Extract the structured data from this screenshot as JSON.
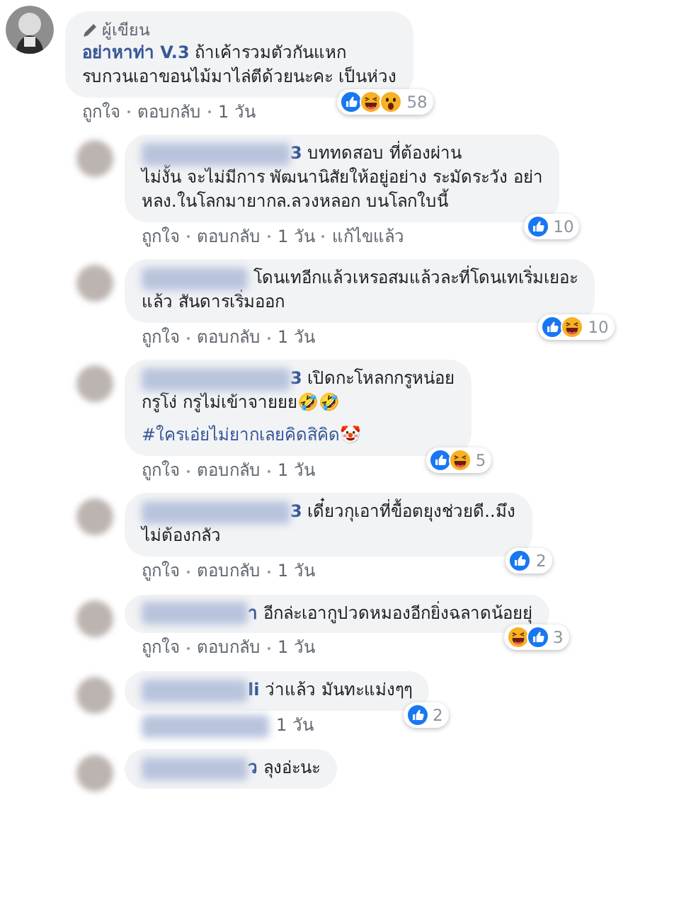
{
  "post_comment": {
    "author_badge": "ผู้เขียน",
    "name": "อย่าหาท่า V.3",
    "lines": [
      "ถ้าเค้ารวมตัวกันแหก",
      "รบกวนเอาขอนไม้มาไล่ตีด้วยนะคะ เป็นห่วง"
    ],
    "reactions": [
      {
        "kind": "like"
      },
      {
        "kind": "haha"
      },
      {
        "kind": "wow"
      }
    ],
    "reaction_count": "58",
    "actions": [
      "ถูกใจ",
      "ตอบกลับ",
      "1 วัน"
    ]
  },
  "replies": [
    {
      "name_fragment": "3",
      "lines": [
        "บททดสอบ ที่ต้องผ่าน",
        "ไม่งั้น จะไม่มีการ พัฒนานิสัยให้อยู่อย่าง ระมัดระวัง อย่า",
        "หลง.ในโลกมายากล.ลวงหลอก บนโลกใบนี้"
      ],
      "reactions": [
        {
          "kind": "like"
        }
      ],
      "reaction_count": "10",
      "actions": [
        "ถูกใจ",
        "ตอบกลับ",
        "1 วัน",
        "แก้ไขแล้ว"
      ]
    },
    {
      "lines": [
        "โดนเทอีกแล้วเหรอสมแล้วละที่โดนเทเริ่มเยอะ",
        "แล้ว สันดารเริ่มออก"
      ],
      "reactions": [
        {
          "kind": "like"
        },
        {
          "kind": "haha"
        }
      ],
      "reaction_count": "10",
      "actions": [
        "ถูกใจ",
        "ตอบกลับ",
        "1 วัน"
      ]
    },
    {
      "name_fragment": "3",
      "lines": [
        "เปิดกะโหลกกรูหน่อย",
        "กรูโง่ กรูไม่เข้าจายยย🤣🤣"
      ],
      "hashtag": "#ใครเอ่ยไม่ยากเลยคิดสิคิด🤡",
      "reactions": [
        {
          "kind": "like"
        },
        {
          "kind": "haha"
        }
      ],
      "reaction_count": "5",
      "actions": [
        "ถูกใจ",
        "ตอบกลับ",
        "1 วัน"
      ]
    },
    {
      "name_fragment": "3",
      "lines": [
        "เดี๋ยวกุเอาที่ขื้อตยุงช่วยดี..มึง",
        "ไม่ต้องกลัว"
      ],
      "reactions": [
        {
          "kind": "like"
        }
      ],
      "reaction_count": "2",
      "actions": [
        "ถูกใจ",
        "ตอบกลับ",
        "1 วัน"
      ]
    },
    {
      "name_fragment": "า",
      "lines": [
        "อีกล่ะเอากูปวดหมองอีกยิ่งฉลาดน้อยยุ่"
      ],
      "reactions": [
        {
          "kind": "haha"
        },
        {
          "kind": "like"
        }
      ],
      "reaction_count": "3",
      "actions": [
        "ถูกใจ",
        "ตอบกลับ",
        "1 วัน"
      ]
    },
    {
      "name_fragment": "li",
      "lines": [
        "ว่าแล้ว มันทะแม่งๆๆ"
      ],
      "reactions": [
        {
          "kind": "like"
        }
      ],
      "reaction_count": "2",
      "actions": [
        "1 วัน"
      ]
    },
    {
      "name_fragment": "ว",
      "lines": [
        "ลุงอ่ะนะ"
      ]
    }
  ]
}
